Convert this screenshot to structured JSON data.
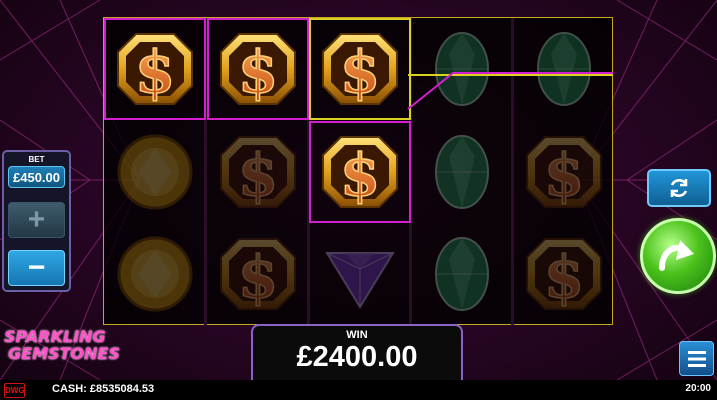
{
  "game": {
    "logo_line1": "SPARKLING",
    "logo_line2": "GEMSTONES"
  },
  "bet": {
    "label": "BET",
    "value": "£450.00",
    "plus": "+",
    "minus": "−"
  },
  "win": {
    "label": "WIN",
    "amount": "£2400.00"
  },
  "status_bar": {
    "brand": "DWG",
    "cash": "CASH: £8535084.53",
    "clock": "20:00"
  },
  "buttons": {
    "autoplay_icon": "refresh-icon",
    "spin_icon": "curved-arrow-icon",
    "menu_icon": "hamburger-menu-icon"
  },
  "reels": {
    "columns": 5,
    "rows": 3,
    "symbols": [
      [
        "dollar",
        "gold-coin",
        "gold-coin"
      ],
      [
        "dollar",
        "dollar",
        "dollar"
      ],
      [
        "dollar",
        "dollar",
        "purple-gem"
      ],
      [
        "green-gem",
        "green-gem",
        "green-gem"
      ],
      [
        "green-gem",
        "dollar",
        "dollar"
      ]
    ],
    "highlighted": [
      [
        0,
        0
      ],
      [
        1,
        0
      ],
      [
        2,
        0
      ],
      [
        2,
        1
      ]
    ]
  },
  "colors": {
    "win_frame": "#d41fd0",
    "payline": "#d9d221",
    "reel_border": "#c8a51e"
  }
}
